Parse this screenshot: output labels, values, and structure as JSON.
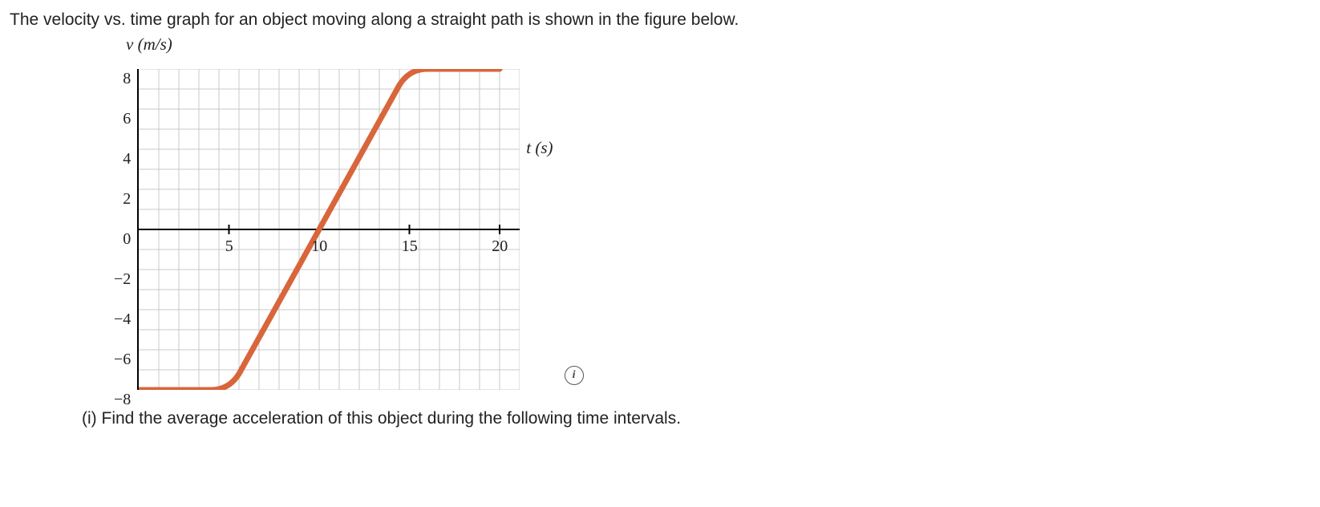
{
  "prompt": "The velocity vs. time graph for an object moving along a straight path is shown in the figure below.",
  "chart_data": {
    "type": "line",
    "title": "",
    "xlabel": "t (s)",
    "ylabel": "v (m/s)",
    "xlim": [
      0,
      21
    ],
    "ylim": [
      -8,
      8
    ],
    "x_ticks": [
      5,
      10,
      15,
      20
    ],
    "y_ticks": [
      8,
      6,
      4,
      2,
      0,
      -2,
      -4,
      -6,
      -8
    ],
    "y_tick_labels": [
      "8",
      "6",
      "4",
      "2",
      "0",
      "−2",
      "−4",
      "−6",
      "−8"
    ],
    "series": [
      {
        "name": "velocity",
        "color": "#d9653b",
        "points": [
          {
            "t": 0,
            "v": -8
          },
          {
            "t": 5,
            "v": -8
          },
          {
            "t": 15,
            "v": 8
          },
          {
            "t": 20,
            "v": 8
          }
        ]
      }
    ]
  },
  "info_icon_label": "i",
  "question": "(i) Find the average acceleration of this object during the following time intervals."
}
